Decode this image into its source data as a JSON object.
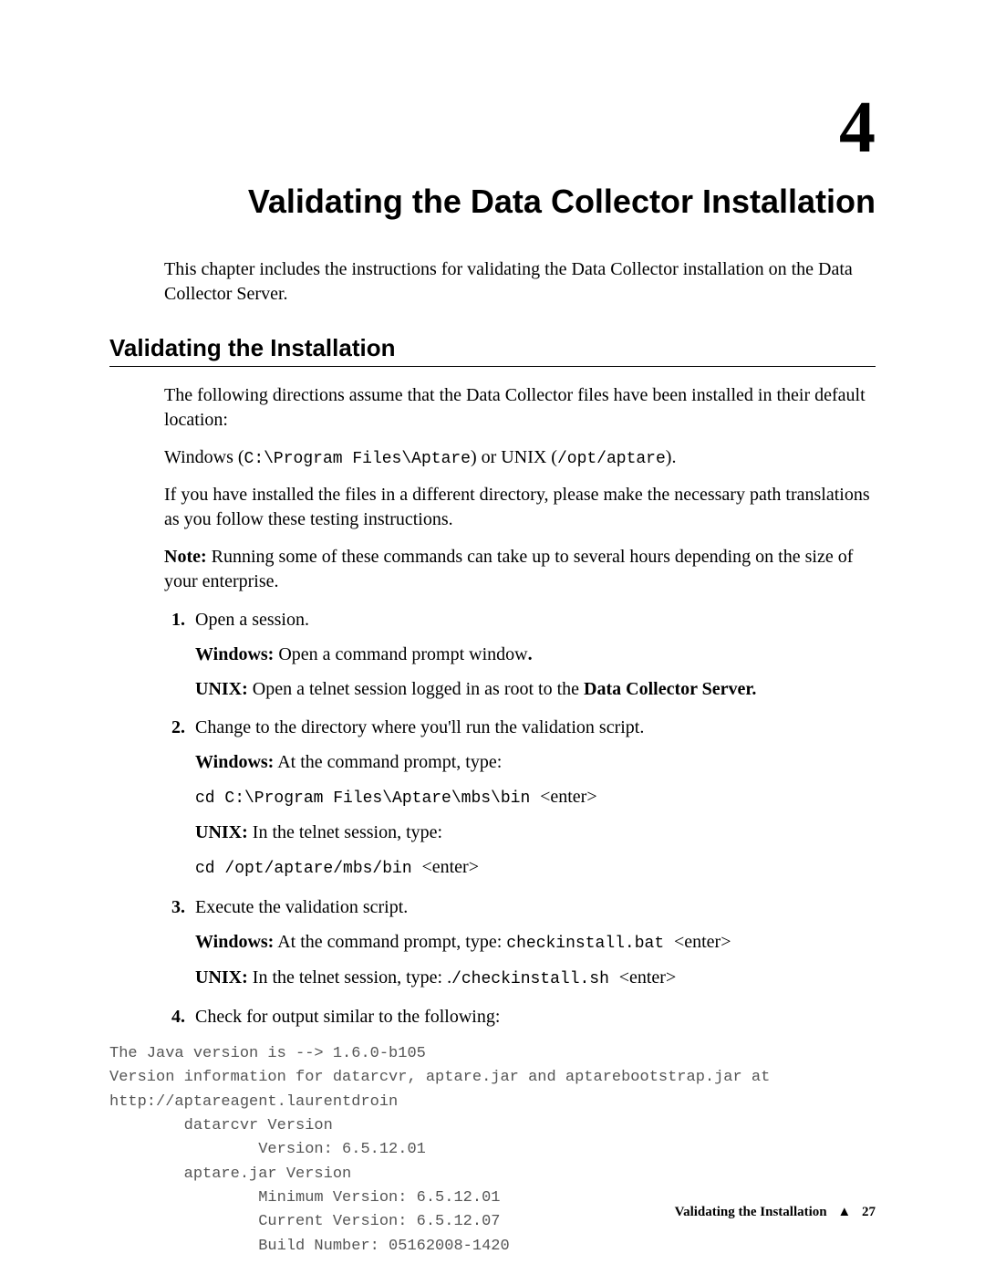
{
  "chapter": {
    "number": "4",
    "title": "Validating the Data Collector Installation",
    "intro": "This chapter includes the instructions for validating the Data Collector installation on the Data Collector Server."
  },
  "section": {
    "heading": "Validating the Installation",
    "p1": "The following directions assume that the Data Collector files have been installed in their default location:",
    "p2_pre": "Windows (",
    "p2_path_win": "C:\\Program Files\\Aptare",
    "p2_mid": ") or UNIX (",
    "p2_path_unix": "/opt/aptare",
    "p2_post": ").",
    "p3": "If you have installed the files in a different directory, please make the necessary path translations as you follow these testing instructions.",
    "note_label": "Note:",
    "note_body": "  Running some of these commands can take up to several hours depending on the size of your enterprise."
  },
  "steps": {
    "s1": {
      "text": "Open a session.",
      "win_label": "Windows:",
      "win_body": " Open a command prompt window",
      "win_stop": ".",
      "unix_label": "UNIX:",
      "unix_body": " Open a telnet session logged in as root to the ",
      "unix_bold": "Data Collector Server."
    },
    "s2": {
      "text": "Change to the directory where you'll run the validation script.",
      "win_label": "Windows:",
      "win_body": " At the command prompt, type:",
      "win_cmd": "cd C:\\Program Files\\Aptare\\mbs\\bin ",
      "win_enter": "<enter>",
      "unix_label": "UNIX:",
      "unix_body": " In the telnet session, type:",
      "unix_cmd": "cd /opt/aptare/mbs/bin ",
      "unix_enter": "<enter>"
    },
    "s3": {
      "text": "Execute the validation script.",
      "win_label": "Windows:",
      "win_body": " At the command prompt, type: ",
      "win_cmd": "checkinstall.bat ",
      "win_enter": "<enter>",
      "unix_label": "UNIX:",
      "unix_body": " In the telnet session, type: .",
      "unix_cmd": "/checkinstall.sh ",
      "unix_enter": "<enter>"
    },
    "s4": {
      "text": "Check for output similar to the following:"
    }
  },
  "output": "The Java version is --> 1.6.0-b105\nVersion information for datarcvr, aptare.jar and aptarebootstrap.jar at\nhttp://aptareagent.laurentdroin\n        datarcvr Version\n                Version: 6.5.12.01\n        aptare.jar Version\n                Minimum Version: 6.5.12.01\n                Current Version: 6.5.12.07\n                Build Number: 05162008-1420",
  "footer": {
    "title": "Validating the Installation",
    "sep": "▲",
    "page": "27"
  }
}
